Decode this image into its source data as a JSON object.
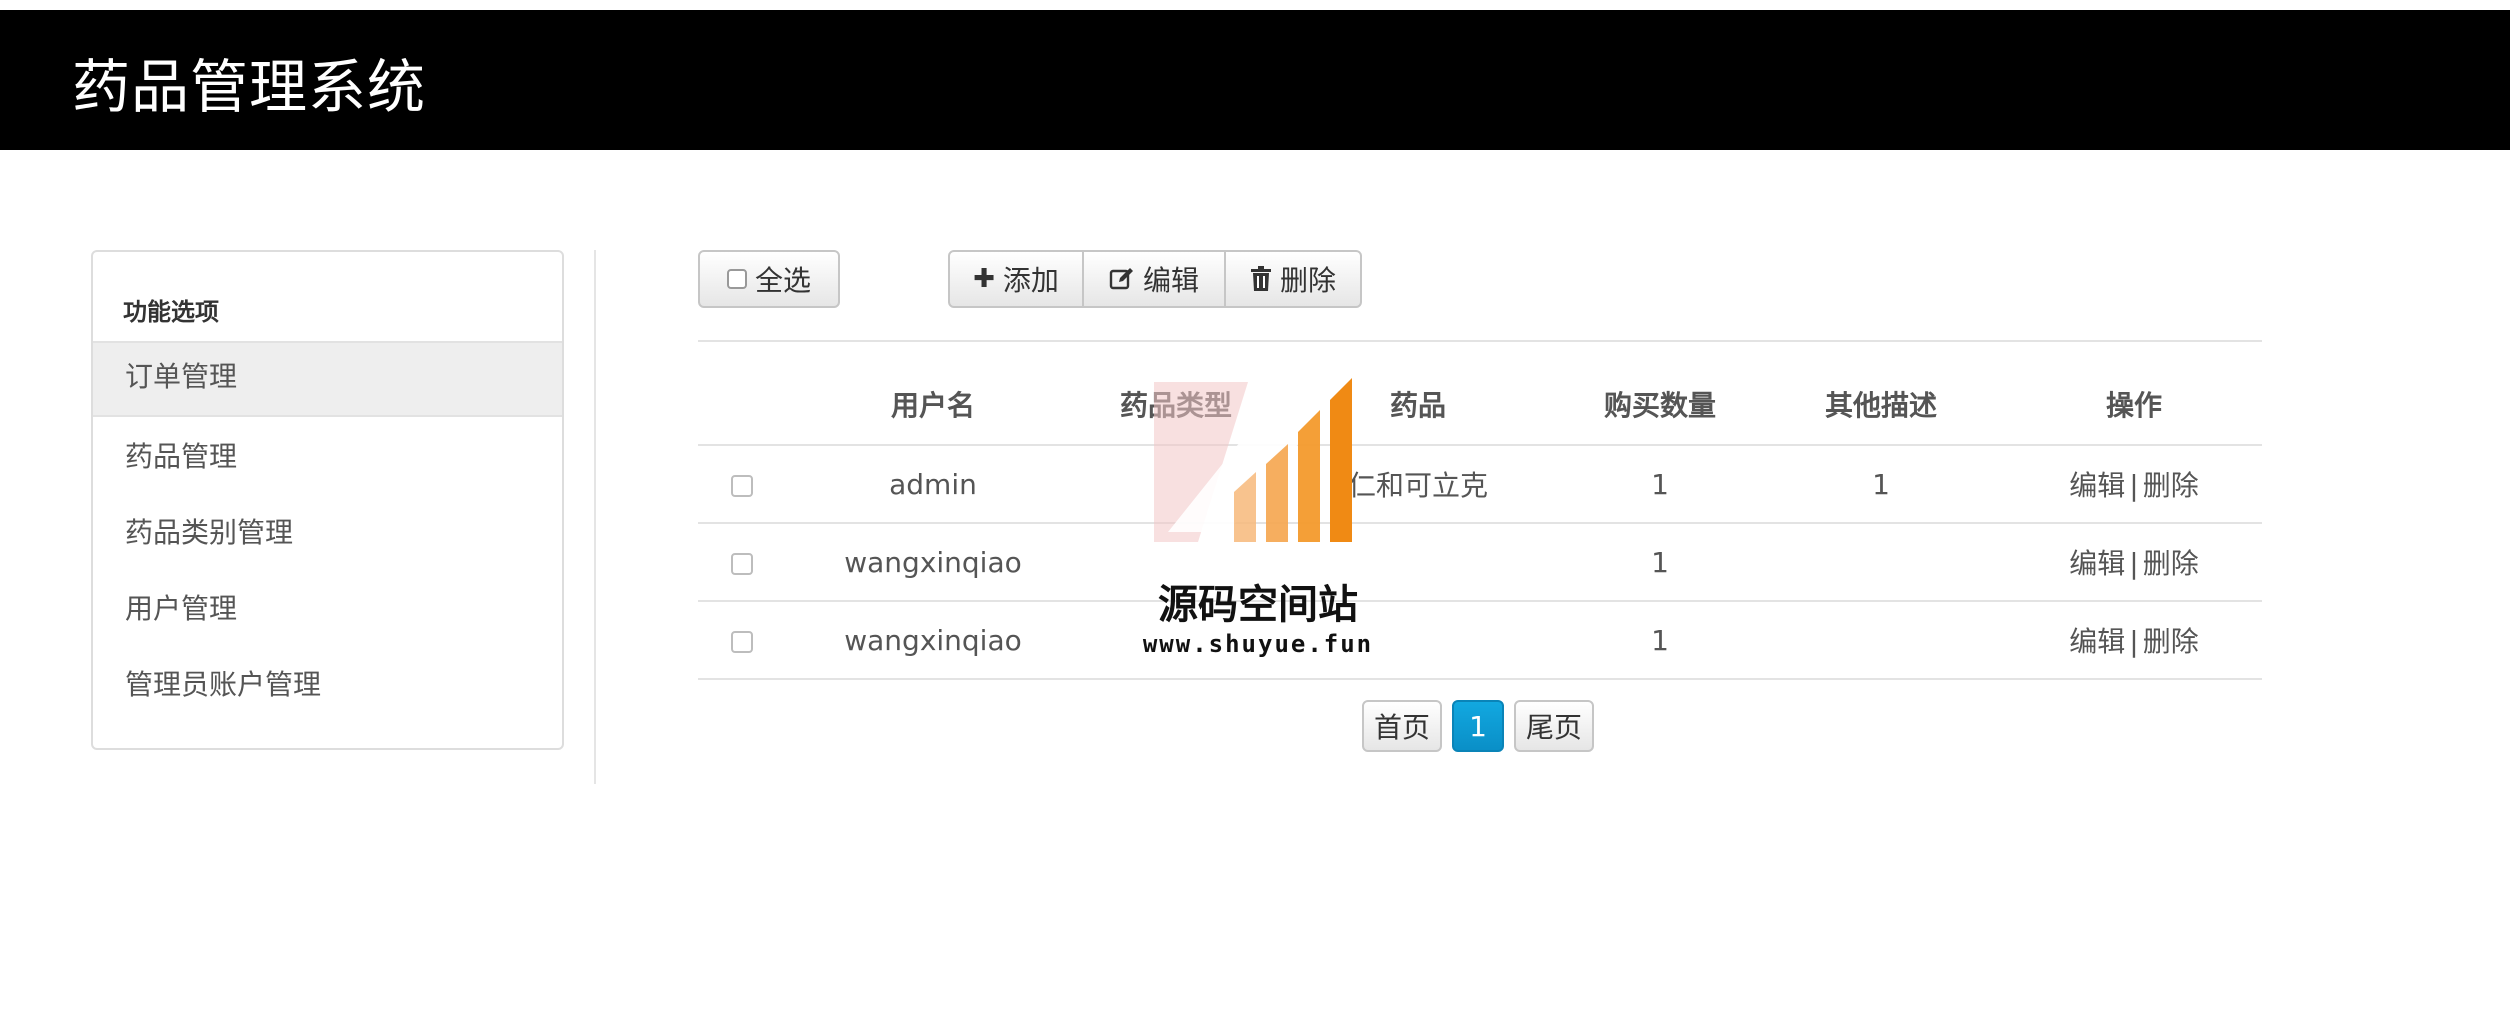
{
  "app": {
    "title": "药品管理系统"
  },
  "sidebar": {
    "header": "功能选项",
    "items": [
      {
        "label": "订单管理",
        "active": true
      },
      {
        "label": "药品管理",
        "active": false
      },
      {
        "label": "药品类别管理",
        "active": false
      },
      {
        "label": "用户管理",
        "active": false
      },
      {
        "label": "管理员账户管理",
        "active": false
      }
    ]
  },
  "toolbar": {
    "select_all_label": "全选",
    "add_label": "添加",
    "edit_label": "编辑",
    "delete_label": "删除",
    "add_icon": "plus-icon",
    "edit_icon": "edit-icon",
    "delete_icon": "trash-icon"
  },
  "table": {
    "columns": [
      "",
      "用户名",
      "药品类型",
      "药品",
      "购买数量",
      "其他描述",
      "操作"
    ],
    "rows": [
      {
        "username": "admin",
        "type": "",
        "drug": "仁和可立克",
        "quantity": "1",
        "desc": "1"
      },
      {
        "username": "wangxinqiao",
        "type": "",
        "drug": "",
        "quantity": "1",
        "desc": ""
      },
      {
        "username": "wangxinqiao",
        "type": "",
        "drug": "",
        "quantity": "1",
        "desc": ""
      }
    ],
    "action_edit": "编辑",
    "action_separator": "|",
    "action_delete": "删除"
  },
  "pagination": {
    "first": "首页",
    "current": "1",
    "last": "尾页"
  },
  "watermark": {
    "title": "源码空间站",
    "url": "www.shuyue.fun"
  },
  "colors": {
    "header_bg": "#000000",
    "accent": "#0a9ad6",
    "watermark_orange": "#f39a2c",
    "watermark_pink": "#f2c6c6"
  }
}
